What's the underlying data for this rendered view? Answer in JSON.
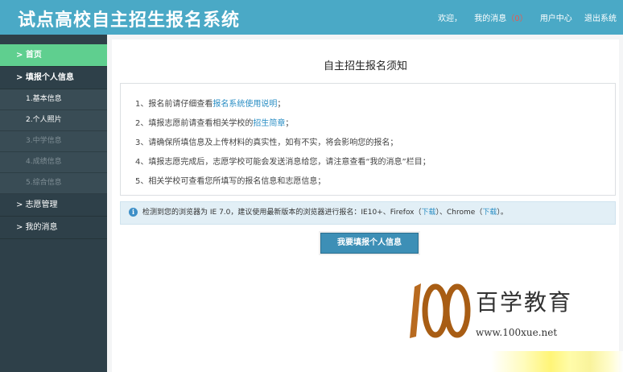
{
  "header": {
    "title": "试点高校自主招生报名系统",
    "welcome": "欢迎，",
    "messages_label": "我的消息",
    "messages_count": "（0）",
    "user_center": "用户中心",
    "logout": "退出系统"
  },
  "sidebar": {
    "home": "> 首页",
    "fill_info": "> 填报个人信息",
    "sub_items": [
      "1.基本信息",
      "2.个人照片",
      "3.中学信息",
      "4.成绩信息",
      "5.综合信息"
    ],
    "volunteer": "> 志愿管理",
    "my_messages": "> 我的消息"
  },
  "main": {
    "page_title": "自主招生报名须知",
    "notice": {
      "line1_pre": "1、报名前请仔细查看",
      "line1_link": "报名系统使用说明",
      "line1_post": "；",
      "line2_pre": "2、填报志愿前请查看相关学校的",
      "line2_link": "招生简章",
      "line2_post": "；",
      "line3": "3、请确保所填信息及上传材料的真实性，如有不实，将会影响您的报名；",
      "line4": "4、填报志愿完成后，志愿学校可能会发送消息给您，请注意查看“我的消息”栏目；",
      "line5": "5、相关学校可查看您所填写的报名信息和志愿信息；"
    },
    "browser_tip": {
      "icon": "i",
      "text1": "检测到您的浏览器为 IE 7.0，建议使用最新版本的浏览器进行报名：IE10+、Firefox（",
      "link1": "下载",
      "text2": "）、Chrome（",
      "link2": "下载",
      "text3": "）。"
    },
    "action_button": "我要填报个人信息"
  },
  "watermark": {
    "brand": "百学教育",
    "url": "www.100xue.net"
  }
}
